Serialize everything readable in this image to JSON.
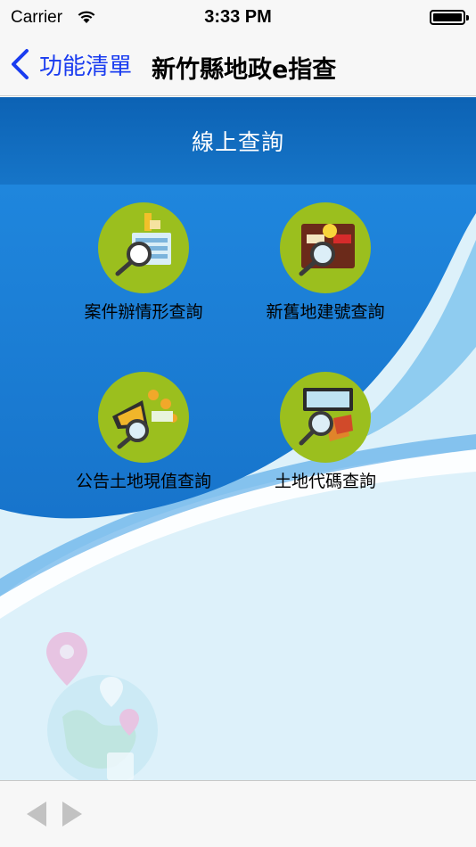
{
  "status_bar": {
    "carrier": "Carrier",
    "time": "3:33 PM"
  },
  "nav": {
    "back_label": "功能清單",
    "title": "新竹縣地政e指查"
  },
  "section": {
    "title": "線上查詢"
  },
  "menu": [
    {
      "label": "案件辦情形查詢",
      "icon": "case-search-icon"
    },
    {
      "label": "新舊地建號查詢",
      "icon": "building-number-icon"
    },
    {
      "label": "公告土地現值查詢",
      "icon": "land-value-icon"
    },
    {
      "label": "土地代碼查詢",
      "icon": "land-code-icon"
    }
  ],
  "colors": {
    "accent": "#1a3cf0",
    "header_blue": "#0c62b4",
    "wave_blue": "#1e80d8",
    "icon_circle": "#9bbf1e",
    "content_bg": "#ddf1fa"
  }
}
